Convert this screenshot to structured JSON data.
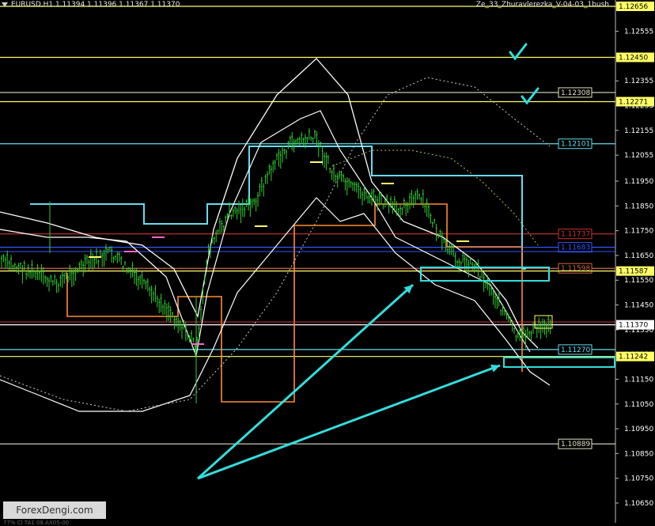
{
  "header": {
    "title": "EURUSD,H1  1.11394 1.11396 1.11367 1.11370",
    "indicator": "Ze_33_Zhuravlerezka_V-04-03_1bush"
  },
  "watermark": "ForexDengi.com",
  "footer_text": "77% Cl TA1 08.AX05-00",
  "colors": {
    "background": "#000000",
    "candle": "#33cc33",
    "yellow_level": "#ffff66",
    "light_level": "#e0e0c0",
    "cyan": "#66ddee",
    "blue": "#3355ff",
    "red": "#cc3333",
    "orange": "#ff8c33",
    "envelope": "#ffffff",
    "check": "#33dddd"
  },
  "price_axis": {
    "ticks": [
      "1.12656",
      "1.12555",
      "1.12355",
      "1.12255",
      "1.12155",
      "1.12055",
      "1.11950",
      "1.11850",
      "1.11750",
      "1.11650",
      "1.11550",
      "1.11450",
      "1.11350",
      "1.11250",
      "1.11150",
      "1.11050",
      "1.10950",
      "1.10850",
      "1.10750",
      "1.10650"
    ],
    "tick_labels": [
      "1.12656",
      "1.12555",
      "1.12355",
      "1.12255",
      "1.12155",
      "1.12055",
      "1.11950",
      "1.11850",
      "1.11750",
      "1.11650",
      "1.11550",
      "1.11450",
      "1.11350",
      "1.11250",
      "1.11150",
      "1.11050",
      "1.10950",
      "1.10850",
      "1.10750",
      "1.10650"
    ]
  },
  "levels": [
    {
      "price": 1.12656,
      "label": "1.12656",
      "color": "#ffff66",
      "tag": "axis"
    },
    {
      "price": 1.1245,
      "label": "1.12450",
      "color": "#ffff66",
      "tag": "axis"
    },
    {
      "price": 1.12308,
      "label": "1.12308",
      "color": "#e0e0c0",
      "tag": "inner"
    },
    {
      "price": 1.12271,
      "label": "1.12271",
      "color": "#ffff66",
      "tag": "axis"
    },
    {
      "price": 1.12101,
      "label": "1.12101",
      "color": "#66ddee",
      "tag": "inner"
    },
    {
      "price": 1.11737,
      "label": "1.11737",
      "color": "#cc3333",
      "tag": "inner"
    },
    {
      "price": 1.11683,
      "label": "1.11683",
      "color": "#3355ff",
      "tag": "inner"
    },
    {
      "price": 1.11598,
      "label": "1.11598",
      "color": "#cc6644",
      "tag": "inner"
    },
    {
      "price": 1.11587,
      "label": "1.11587",
      "color": "#ffff66",
      "tag": "axis"
    },
    {
      "price": 1.1137,
      "label": "1.11370",
      "color": "#ffffff",
      "tag": "axis-current"
    },
    {
      "price": 1.1127,
      "label": "1.11270",
      "color": "#66ddee",
      "tag": "inner"
    },
    {
      "price": 1.11242,
      "label": "1.11242",
      "color": "#ffff66",
      "tag": "axis"
    },
    {
      "price": 1.10889,
      "label": "1.10889",
      "color": "#e0e0c0",
      "tag": "inner"
    }
  ]
}
